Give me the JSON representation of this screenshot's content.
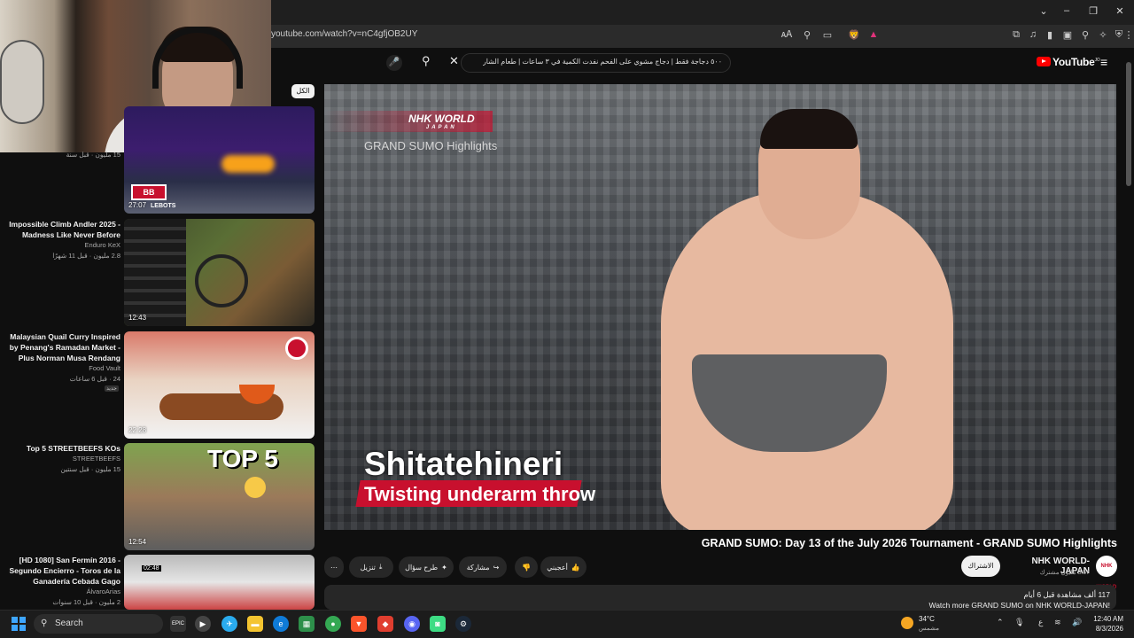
{
  "browser": {
    "url": "youtube.com/watch?v=nC4gfjOB2UY",
    "window_controls": [
      "⌄",
      "–",
      "❐",
      "✕"
    ],
    "extension_icons": [
      "⧉",
      "♫",
      "▮",
      "▣",
      "⚲",
      "✧",
      "⛨",
      "⋮"
    ],
    "addr_icons": [
      "🗚",
      "⚲",
      "▭",
      "🦁",
      "▲"
    ]
  },
  "youtube": {
    "logo_text": "YouTube",
    "logo_sup": "JO",
    "search_query": "٥٠٠ دجاجة فقط | دجاج مشوي على الفحم نفدت الكمية في ٣ ساعات | طعام الشارع التايلاندي",
    "sidebar_top_label": "الكل",
    "sidebar_top_meta": "15 مليون · قبل سنة"
  },
  "sidebar_videos": [
    {
      "title": "",
      "channel": "",
      "meta": "",
      "duration": "27:07",
      "thumb_label": "LEBOTS"
    },
    {
      "title": "Impossible Climb Andler 2025 - Madness Like Never Before",
      "channel": "Enduro KeX",
      "meta": "2.8 مليون · قبل 11 شهرًا",
      "duration": "12:43"
    },
    {
      "title": "Malaysian Quail Curry Inspired by Penang's Ramadan Market - Plus Norman Musa Rendang",
      "channel": "Food Vault",
      "meta": "24 · قبل 6 ساعات",
      "duration": "22:28",
      "badge": "جديد"
    },
    {
      "title": "Top 5 STREETBEEFS KOs",
      "channel": "STREETBEEFS",
      "meta": "15 مليون · قبل سنتين",
      "duration": "12:54",
      "thumb_label": "TOP 5"
    },
    {
      "title": "[HD 1080] San Fermín 2016 - Segundo Encierro - Toros de la Ganadería Cebada Gago",
      "channel": "ÁlvaroArias",
      "meta": "2 مليون · قبل 10 سنوات",
      "duration": "02:48"
    }
  ],
  "player": {
    "nhk_logo": "NHK WORLD",
    "nhk_logo_sub": "JAPAN",
    "overlay_subtitle": "GRAND SUMO Highlights",
    "caption_main": "Shitatehineri",
    "caption_sub": "Twisting underarm throw"
  },
  "video": {
    "title": "GRAND SUMO: Day 13 of the July 2026 Tournament - GRAND SUMO Highlights",
    "channel_name": "NHK WORLD-JAPAN",
    "channel_subs": "3.57 مليون مشترك",
    "channel_avatar": "NHK WORLD",
    "subscribe_label": "الاشتراك",
    "like_label": "أعجبني",
    "share_label": "مشاركة",
    "ask_label": "طرح سؤال",
    "download_label": "تنزيل",
    "description_views": "117 ألف مشاهدة قبل 6 أيام",
    "description_text": "Watch more GRAND SUMO on NHK WORLD-JAPAN!"
  },
  "taskbar": {
    "search_placeholder": "Search",
    "weather_temp": "34°C",
    "weather_desc": "مشمس",
    "lang": "ع",
    "time": "12:40 AM",
    "date": "8/3/2026"
  }
}
